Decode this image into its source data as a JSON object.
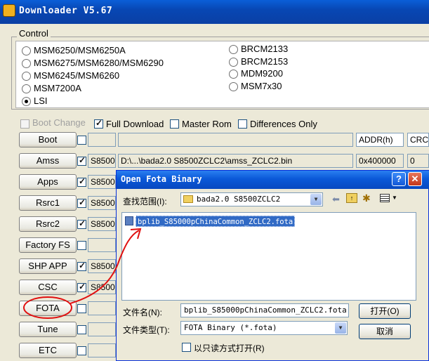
{
  "window": {
    "title": "Downloader V5.67"
  },
  "control": {
    "label": "Control",
    "left_options": [
      "MSM6250/MSM6250A",
      "MSM6275/MSM6280/MSM6290",
      "MSM6245/MSM6260",
      "MSM7200A",
      "LSI"
    ],
    "right_options": [
      "BRCM2133",
      "BRCM2153",
      "MDM9200",
      "MSM7x30"
    ],
    "selected": "LSI"
  },
  "options": {
    "boot_change": "Boot Change",
    "full_download": "Full Download",
    "master_rom": "Master Rom",
    "differences_only": "Differences Only"
  },
  "table": {
    "addr_header": "ADDR(h)",
    "crc_header": "CRC"
  },
  "rows": [
    {
      "button": "Boot",
      "model": "",
      "path": "",
      "addr": "",
      "crc": ""
    },
    {
      "button": "Amss",
      "model": "S8500",
      "path": "D:\\...\\bada2.0 S8500ZCLC2\\amss_ZCLC2.bin",
      "addr": "0x400000",
      "crc": "0"
    },
    {
      "button": "Apps",
      "model": "S8500"
    },
    {
      "button": "Rsrc1",
      "model": "S8500"
    },
    {
      "button": "Rsrc2",
      "model": "S8500"
    },
    {
      "button": "Factory FS",
      "model": ""
    },
    {
      "button": "SHP APP",
      "model": "S8500"
    },
    {
      "button": "CSC",
      "model": "S8500"
    },
    {
      "button": "FOTA",
      "model": ""
    },
    {
      "button": "Tune",
      "model": ""
    },
    {
      "button": "ETC",
      "model": ""
    }
  ],
  "dialog": {
    "title": "Open Fota Binary",
    "help": "?",
    "close": "✕",
    "look_in_label": "查找范围(I):",
    "look_in_value": "bada2.0 S8500ZCLC2",
    "selected_file": "bplib_S85000pChinaCommon_ZCLC2.fota",
    "filename_label": "文件名(N):",
    "filename_value": "bplib_S85000pChinaCommon_ZCLC2.fota",
    "filetype_label": "文件类型(T):",
    "filetype_value": "FOTA Binary (*.fota)",
    "readonly_label": "以只读方式打开(R)",
    "open_button": "打开(O)",
    "cancel_button": "取消"
  },
  "colors": {
    "title_blue": "#0a5fd8",
    "annotation_red": "#e01010",
    "selection_blue": "#316ac5"
  }
}
